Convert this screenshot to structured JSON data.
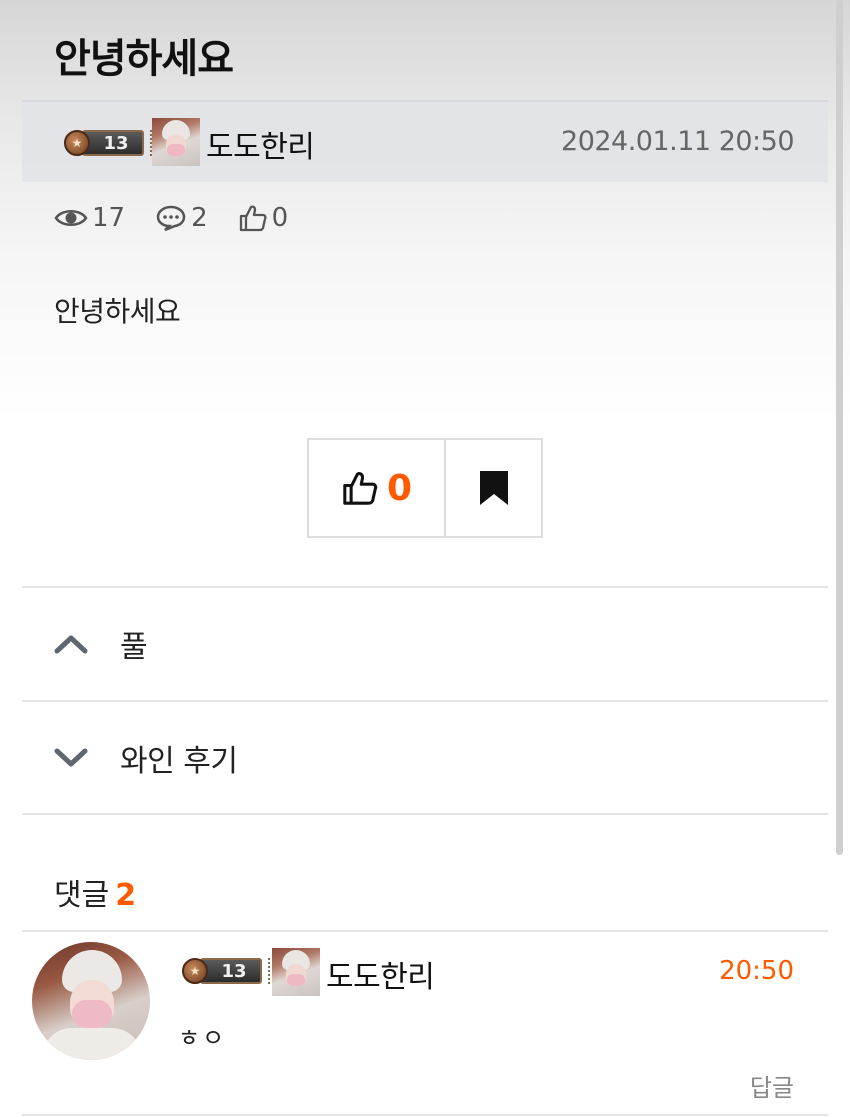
{
  "post": {
    "title": "안녕하세요",
    "author": {
      "level": "13",
      "name": "도도한리"
    },
    "date": "2024.01.11 20:50",
    "stats": {
      "views": "17",
      "comments": "2",
      "likes": "0"
    },
    "body": "안녕하세요"
  },
  "actions": {
    "like_count": "0"
  },
  "navigation": {
    "prev_label": "풀",
    "next_label": "와인 후기"
  },
  "comments": {
    "header_label": "댓글",
    "count": "2",
    "items": [
      {
        "level": "13",
        "author": "도도한리",
        "time": "20:50",
        "text": "ㅎㅇ",
        "reply_label": "답글"
      }
    ]
  },
  "colors": {
    "accent": "#ff5a00",
    "muted_text": "#666666",
    "divider": "#e4e4e4"
  }
}
